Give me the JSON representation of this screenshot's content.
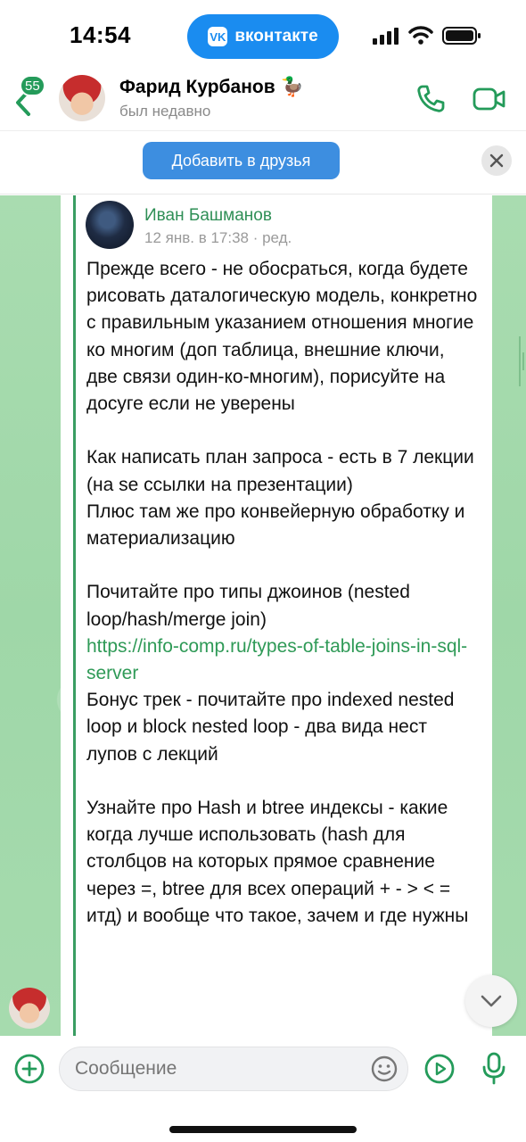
{
  "status_bar": {
    "time": "14:54",
    "app_pill_label": "вконтакте",
    "app_pill_logo": "VK",
    "accent_color": "#1a8cf0"
  },
  "header": {
    "unread_count": "55",
    "contact_name": "Фарид Курбанов 🦆",
    "contact_status": "был недавно",
    "accent_color": "#249b5a"
  },
  "friend_bar": {
    "add_friend_label": "Добавить в друзья"
  },
  "message": {
    "author_name": "Иван Башманов",
    "meta": "12 янв. в 17:38 · ред.",
    "paragraphs": [
      [
        "Прежде всего - не обосраться, когда будете рисовать даталогическую модель, конкретно с правильным указанием отношения многие ко многим (доп таблица, внешние ключи, две связи один-ко-многим), порисуйте на досуге если не уверены"
      ],
      [
        "Как написать план запроса - есть в 7 лекции (на se ссылки на презентации)",
        "Плюс там же про конвейерную обработку и материализацию"
      ],
      [
        "Почитайте про типы джоинов (nested loop/hash/merge join)",
        "https://info-comp.ru/types-of-table-joins-in-sql-server",
        "Бонус трек - почитайте про indexed nested loop и block nested loop - два вида нест лупов с лекций"
      ],
      [
        "Узнайте про Hash и btree индексы - какие когда лучше использовать (hash для столбцов на которых прямое сравнение через =, btree для всех операций + - > < = итд) и вообще что такое, зачем и где нужны"
      ]
    ]
  },
  "composer": {
    "placeholder": "Сообщение"
  },
  "icons": [
    "back-arrow-icon",
    "phone-icon",
    "video-camera-icon",
    "close-icon",
    "chevron-down-icon",
    "plus-icon",
    "emoji-icon",
    "play-icon",
    "microphone-icon"
  ]
}
